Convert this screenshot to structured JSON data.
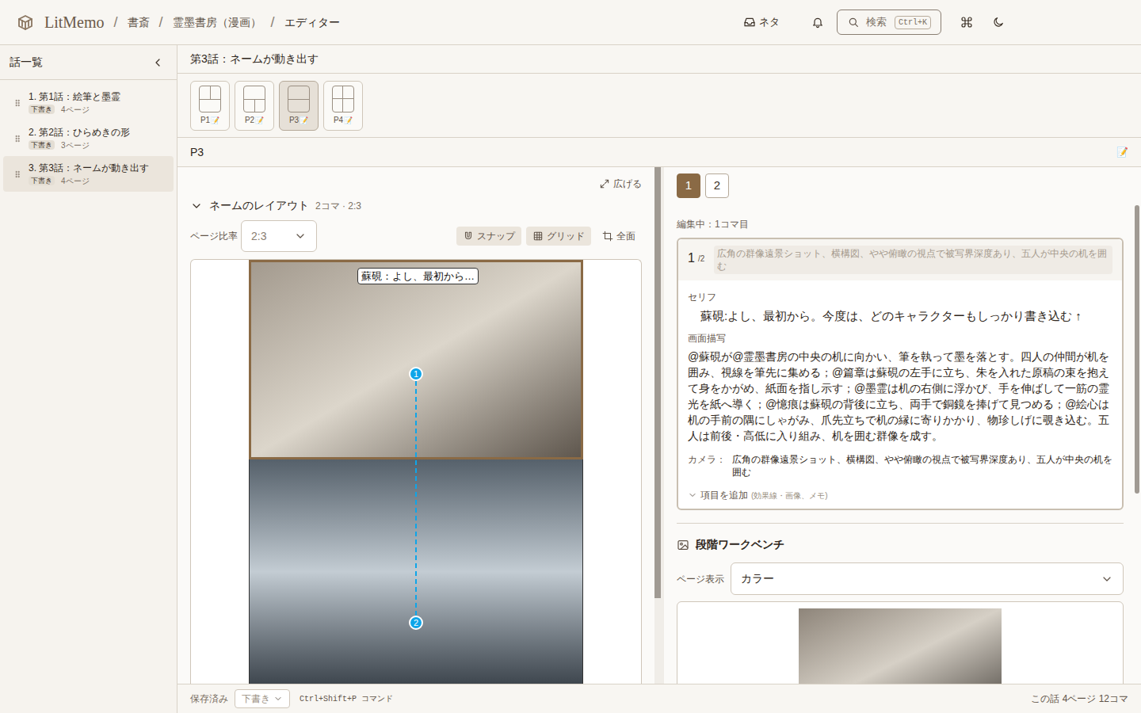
{
  "header": {
    "logo": "LitMemo",
    "separator": "/",
    "breadcrumbs": [
      "書斎",
      "霊墨書房（漫画）",
      "エディター"
    ],
    "inbox_label": "ネタ",
    "search": {
      "label": "検索",
      "shortcut": "Ctrl+K"
    }
  },
  "sidebar": {
    "title": "話一覧",
    "items": [
      {
        "label": "1. 第1話：絵筆と墨霊",
        "status": "下書き",
        "pages": "4ページ",
        "selected": false
      },
      {
        "label": "2. 第2話：ひらめきの形",
        "status": "下書き",
        "pages": "3ページ",
        "selected": false
      },
      {
        "label": "3. 第3話：ネームが動き出す",
        "status": "下書き",
        "pages": "4ページ",
        "selected": true
      }
    ]
  },
  "episode_title": "第3話：ネームが動き出す",
  "pages": [
    {
      "label": "P1",
      "icon": "📝",
      "kind": "split-top",
      "selected": false
    },
    {
      "label": "P2",
      "icon": "📝",
      "kind": "split-bottom",
      "selected": false
    },
    {
      "label": "P3",
      "icon": "📝",
      "kind": "two-rows",
      "selected": true
    },
    {
      "label": "P4",
      "icon": "📝",
      "kind": "four-grid",
      "selected": false
    }
  ],
  "page_label": "P3",
  "page_icon": "📝",
  "layout_panel": {
    "expand": "広げる",
    "title": "ネームのレイアウト",
    "meta": "2コマ · 2:3",
    "expanded": true,
    "ratio_label": "ページ比率",
    "ratio": "2:3",
    "tools": [
      {
        "label": "スナップ",
        "on": true
      },
      {
        "label": "グリッド",
        "on": true
      },
      {
        "label": "全面",
        "on": false
      }
    ],
    "bubble": "蘇硯：よし、最初から…",
    "panels": [
      {
        "number": "1",
        "selected": true
      },
      {
        "number": "2",
        "selected": false
      }
    ]
  },
  "editor": {
    "tabs": [
      {
        "label": "1",
        "selected": true
      },
      {
        "label": "2",
        "selected": false
      }
    ],
    "editing": "編集中：1コマ目",
    "panel_number": "1",
    "panel_total": "/2",
    "summary": "広角の群像遠景ショット、横構図、やや俯瞰の視点で被写界深度あり、五人が中央の机を囲む",
    "dialogue_label": "セリフ",
    "dialogue": "蘇硯:よし、最初から。今度は、どのキャラクターもしっかり書き込む ↑",
    "description_label": "画面描写",
    "description": "@蘇硯が@霊墨書房の中央の机に向かい、筆を執って墨を落とす。四人の仲間が机を囲み、視線を筆先に集める；@篇章は蘇硯の左手に立ち、朱を入れた原稿の束を抱えて身をかがめ、紙面を指し示す；@墨霊は机の右側に浮かび、手を伸ばして一筋の霊光を紙へ導く；@憶痕は蘇硯の背後に立ち、両手で銅鏡を捧げて見つめる；@絵心は机の手前の隅にしゃがみ、爪先立ちで机の縁に寄りかかり、物珍しげに覗き込む。五人は前後・高低に入り組み、机を囲む群像を成す。",
    "camera_label": "カメラ：",
    "camera": "広角の群像遠景ショット、横構図、やや俯瞰の視点で被写界深度あり、五人が中央の机を囲む",
    "add_label": "項目を追加",
    "add_hint": "(効果線・画像、メモ)"
  },
  "workbench": {
    "title": "段階ワークベンチ",
    "view_label": "ページ表示",
    "view": "カラー"
  },
  "status_bar": {
    "saved": "保存済み",
    "status": "下書き",
    "command": "Ctrl+Shift+P コマンド",
    "summary": "この話 4ページ 12コマ"
  }
}
